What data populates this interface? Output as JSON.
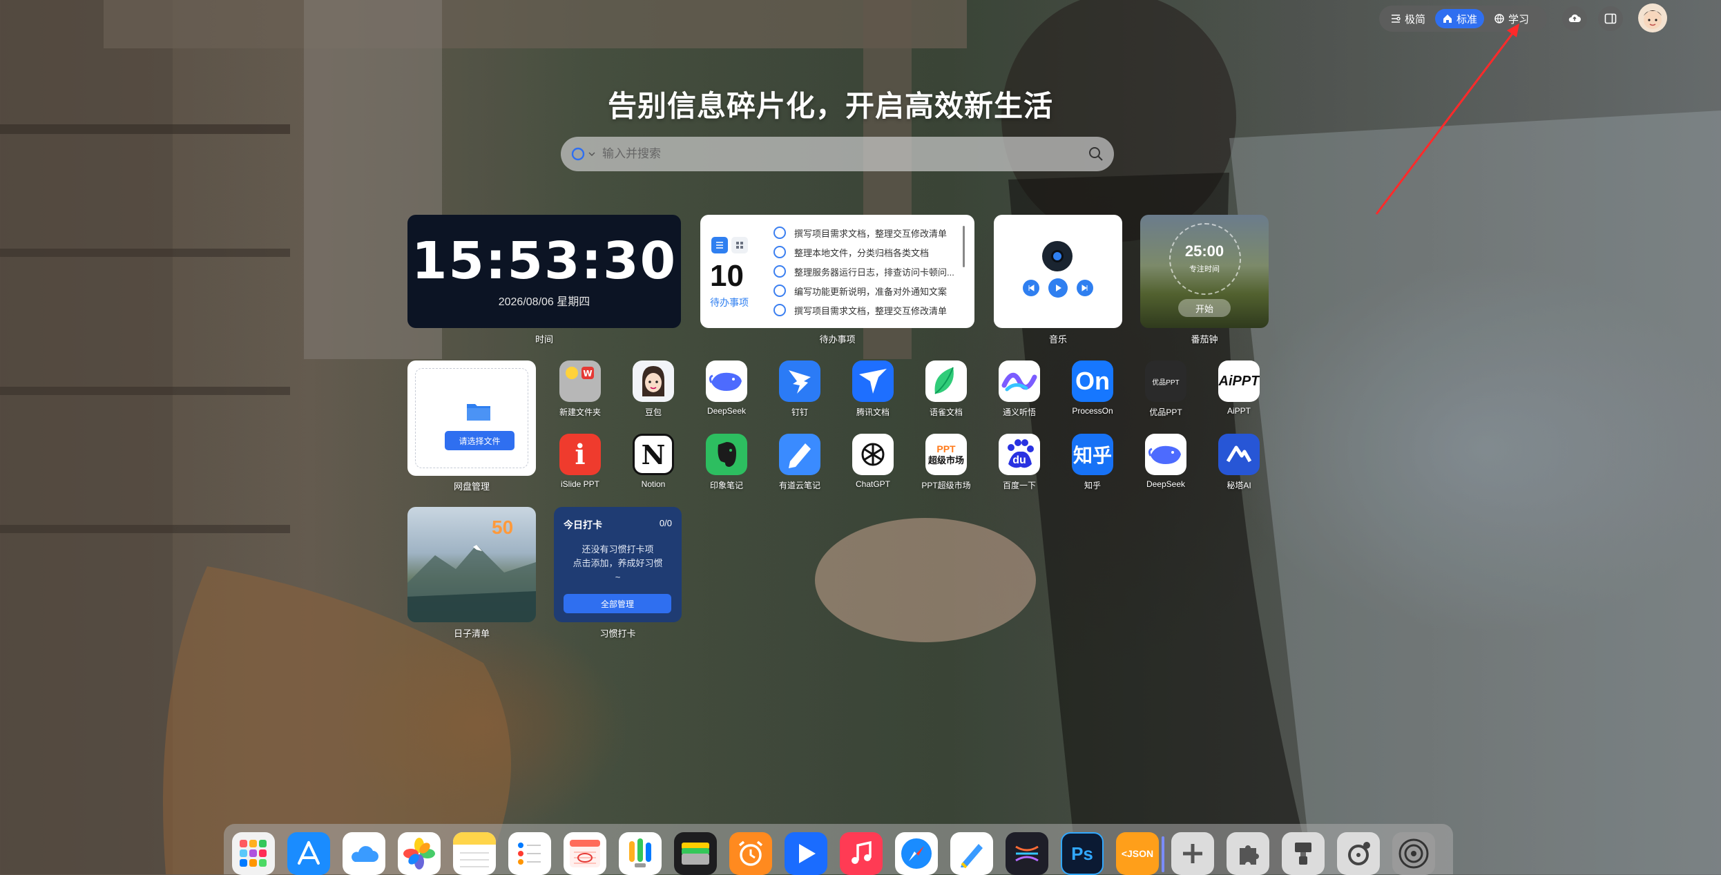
{
  "header": {
    "modes": [
      {
        "label": "极简",
        "icon": "minimal-icon",
        "active": false
      },
      {
        "label": "标准",
        "icon": "home-icon",
        "active": true
      },
      {
        "label": "学习",
        "icon": "globe-icon",
        "active": false
      }
    ],
    "cloud_icon": "cloud-upload-icon",
    "sidebar_icon": "sidebar-toggle-icon",
    "avatar_icon": "user-avatar"
  },
  "headline": "告别信息碎片化，开启高效新生活",
  "search": {
    "placeholder": "输入并搜索",
    "engine_icon": "search-engine-icon",
    "submit_icon": "search-icon"
  },
  "widgets": {
    "clock": {
      "time": "15:53:30",
      "date": "2026/08/06 星期四",
      "label": "时间"
    },
    "todo": {
      "count": "10",
      "count_label": "待办事项",
      "label": "待办事项",
      "items": [
        "撰写项目需求文档，整理交互修改清单",
        "整理本地文件，分类归档各类文档",
        "整理服务器运行日志，排查访问卡顿问...",
        "编写功能更新说明，准备对外通知文案",
        "撰写项目需求文档，整理交互修改清单"
      ]
    },
    "music": {
      "label": "音乐"
    },
    "pomodoro": {
      "time": "25:00",
      "subtitle": "专注时间",
      "start": "开始",
      "label": "番茄钟"
    },
    "netdisk": {
      "button": "请选择文件",
      "label": "网盘管理"
    },
    "days": {
      "count": "50",
      "label": "日子清单"
    },
    "habit": {
      "title": "今日打卡",
      "count": "0/0",
      "message_line1": "还没有习惯打卡项",
      "message_line2": "点击添加，养成好习惯",
      "message_line3": "~",
      "button": "全部管理",
      "label": "习惯打卡"
    }
  },
  "apps": [
    {
      "name": "新建文件夹",
      "icon": "folder-group-icon",
      "color": "#b9b9b9"
    },
    {
      "name": "豆包",
      "icon": "doubao-icon",
      "color": "#f2f4f8"
    },
    {
      "name": "DeepSeek",
      "icon": "deepseek-whale-icon",
      "color": "#ffffff"
    },
    {
      "name": "钉钉",
      "icon": "dingtalk-icon",
      "color": "#2b7bf6"
    },
    {
      "name": "腾讯文档",
      "icon": "tencent-docs-icon",
      "color": "#1e6fff"
    },
    {
      "name": "语雀文档",
      "icon": "yuque-bird-icon",
      "color": "#ffffff"
    },
    {
      "name": "通义听悟",
      "icon": "tingwu-wave-icon",
      "color": "#ffffff"
    },
    {
      "name": "ProcessOn",
      "icon": "processon-icon",
      "color": "#1677ff"
    },
    {
      "name": "优品PPT",
      "icon": "youpin-ppt-icon",
      "color": "#2a2a2a"
    },
    {
      "name": "AiPPT",
      "icon": "aippt-icon",
      "color": "#ffffff"
    },
    {
      "name": "iSlide PPT",
      "icon": "islide-icon",
      "color": "#ef3b2d"
    },
    {
      "name": "Notion",
      "icon": "notion-icon",
      "color": "#ffffff"
    },
    {
      "name": "印象笔记",
      "icon": "evernote-elephant-icon",
      "color": "#2dbe60"
    },
    {
      "name": "有道云笔记",
      "icon": "youdao-note-icon",
      "color": "#3a8bff"
    },
    {
      "name": "ChatGPT",
      "icon": "chatgpt-icon",
      "color": "#ffffff"
    },
    {
      "name": "PPT超级市场",
      "icon": "ppt-market-icon",
      "color": "#ffffff"
    },
    {
      "name": "百度一下",
      "icon": "baidu-paw-icon",
      "color": "#ffffff"
    },
    {
      "name": "知乎",
      "icon": "zhihu-icon",
      "color": "#1772f6"
    },
    {
      "name": "DeepSeek",
      "icon": "deepseek-whale-icon",
      "color": "#ffffff"
    },
    {
      "name": "秘塔AI",
      "icon": "metaso-icon",
      "color": "#2756d6"
    }
  ],
  "app_texts": {
    "processon": "On",
    "aippt": "AiPPT",
    "zhihu": "知乎",
    "ppt_market_top": "PPT",
    "ppt_market_bottom": "超级市场",
    "youpin": "优品PPT",
    "notion": "N",
    "baidu": "du",
    "islide": "i"
  },
  "dock": [
    {
      "icon": "launchpad-icon",
      "color": "#f2f2f2"
    },
    {
      "icon": "app-store-icon",
      "color": "#1a8cff"
    },
    {
      "icon": "icloud-icon",
      "color": "#ffffff"
    },
    {
      "icon": "photos-icon",
      "color": "#ffffff"
    },
    {
      "icon": "notes-icon",
      "color": "#ffffff"
    },
    {
      "icon": "reminders-icon",
      "color": "#ffffff"
    },
    {
      "icon": "calendar-icon",
      "color": "#ffffff"
    },
    {
      "icon": "ideas-bulb-icon",
      "color": "#ffffff"
    },
    {
      "icon": "wallet-icon",
      "color": "#1d1d1f"
    },
    {
      "icon": "alarm-clock-icon",
      "color": "#ff8a1f"
    },
    {
      "icon": "video-play-icon",
      "color": "#1a6cff"
    },
    {
      "icon": "music-icon",
      "color": "#ff3b54"
    },
    {
      "icon": "safari-icon",
      "color": "#ffffff"
    },
    {
      "icon": "freeform-icon",
      "color": "#ffffff"
    },
    {
      "icon": "xmind-icon",
      "color": "#1e1e28"
    },
    {
      "icon": "photoshop-icon",
      "color": "#0b1a33"
    },
    {
      "icon": "json-tool-icon",
      "color": "#ff9f1a"
    },
    {
      "icon": "add-icon",
      "color": "#dcdcdc"
    },
    {
      "icon": "plugins-puzzle-icon",
      "color": "#dcdcdc"
    },
    {
      "icon": "theme-brush-icon",
      "color": "#dcdcdc"
    },
    {
      "icon": "timer-settings-icon",
      "color": "#dcdcdc"
    },
    {
      "icon": "system-settings-icon",
      "color": "#9a9a9a"
    }
  ],
  "dock_texts": {
    "photoshop": "Ps",
    "json": "<JSON"
  }
}
